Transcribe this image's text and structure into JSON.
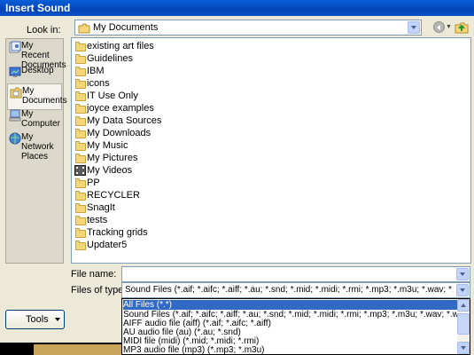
{
  "dialog": {
    "title": "Insert Sound"
  },
  "lookin": {
    "label": "Look in:",
    "value": "My Documents"
  },
  "places": [
    {
      "label": "My Recent Documents",
      "icon": "recent-documents-icon"
    },
    {
      "label": "Desktop",
      "icon": "desktop-icon"
    },
    {
      "label": "My Documents",
      "icon": "my-documents-icon",
      "selected": true
    },
    {
      "label": "My Computer",
      "icon": "computer-icon"
    },
    {
      "label": "My Network Places",
      "icon": "network-places-icon"
    }
  ],
  "files": [
    "existing art files",
    "Guidelines",
    "IBM",
    "icons",
    "IT Use Only",
    "joyce examples",
    "My Data Sources",
    "My Downloads",
    "My Music",
    "My Pictures",
    "My Videos",
    "PP",
    "RECYCLER",
    "SnagIt",
    "tests",
    "Tracking grids",
    "Updater5"
  ],
  "filename": {
    "label": "File name:",
    "value": ""
  },
  "filetype": {
    "label": "Files of type:",
    "value": "Sound Files (*.aif; *.aifc; *.aiff; *.au; *.snd; *.mid; *.midi; *.rmi; *.mp3; *.m3u; *.wav; *.wma; *.w"
  },
  "dropdown_options": [
    "All Files (*.*)",
    "Sound Files (*.aif; *.aifc; *.aiff; *.au; *.snd; *.mid; *.midi; *.rmi; *.mp3; *.m3u; *.wav; *.wma; *.wax)",
    "AIFF audio file (aiff) (*.aif; *.aifc; *.aiff)",
    "AU audio file (au) (*.au; *.snd)",
    "MIDI file (midi) (*.mid; *.midi; *.rmi)",
    "MP3 audio file (mp3) (*.mp3; *.m3u)"
  ],
  "tools": {
    "label": "Tools"
  },
  "colors": {
    "titlebar": "#0a52c6",
    "selection": "#316ac5",
    "dialog_bg": "#ece9d8"
  }
}
